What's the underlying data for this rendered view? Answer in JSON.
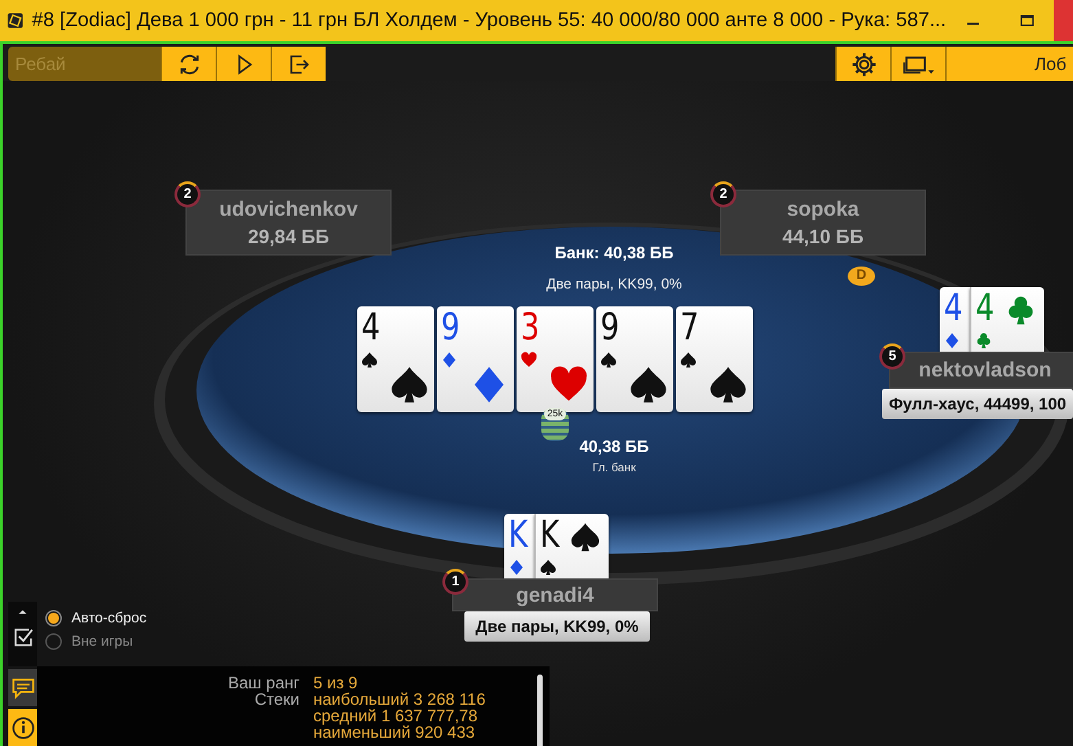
{
  "window": {
    "title": "#8 [Zodiac] Дева 1 000 грн - 11 грн БЛ Холдем - Уровень 55: 40 000/80 000 анте 8 000 - Рука: 587..."
  },
  "toolbar": {
    "rebuy": {
      "label": "Ребай",
      "disabled": true
    },
    "lobby": {
      "label": "Лоб"
    }
  },
  "pot": {
    "title": "Банк: 40,38 ББ",
    "hand": "Две пары, KK99, 0%",
    "chip": "25k",
    "amount": "40,38 ББ",
    "caption": "Гл. банк"
  },
  "board": [
    {
      "rank": "4",
      "kind": "spade"
    },
    {
      "rank": "9",
      "kind": "diamond"
    },
    {
      "rank": "3",
      "kind": "heart"
    },
    {
      "rank": "9",
      "kind": "spade"
    },
    {
      "rank": "7",
      "kind": "spade"
    }
  ],
  "dealer": {
    "label": "D"
  },
  "seats": [
    {
      "name": "udovichenkov",
      "seat": "2",
      "stack": "29,84 ББ"
    },
    {
      "name": "sopoka",
      "seat": "2",
      "stack": "44,10 ББ"
    },
    {
      "name": "nektovladson",
      "seat": "5",
      "hand": "Фулл-хаус, 44499, 100",
      "cards": [
        {
          "rank": "4",
          "kind": "diamond"
        },
        {
          "rank": "4",
          "kind": "club"
        }
      ]
    },
    {
      "name": "genadi4",
      "seat": "1",
      "hand": "Две пары, KK99, 0%",
      "cards": [
        {
          "rank": "K",
          "kind": "diamond"
        },
        {
          "rank": "K",
          "kind": "spade"
        }
      ]
    }
  ],
  "options": [
    {
      "label": "Авто-сброс",
      "selected": true
    },
    {
      "label": "Вне игры",
      "selected": false
    }
  ],
  "info": [
    {
      "label": "Ваш ранг",
      "values": [
        "5 из 9"
      ]
    },
    {
      "label": "Стеки",
      "values": [
        "наибольший 3 268 116",
        "средний 1 637 777,78",
        "наименьший 920 433"
      ]
    }
  ]
}
